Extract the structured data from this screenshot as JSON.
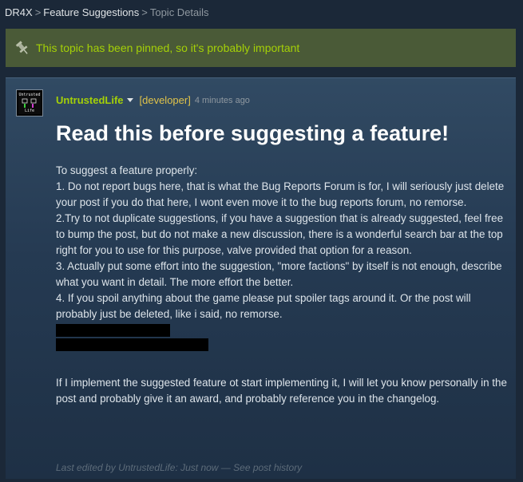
{
  "breadcrumb": {
    "items": [
      "DR4X",
      "Feature Suggestions"
    ],
    "current": "Topic Details",
    "separator": ">"
  },
  "pinned_banner": {
    "icon": "pin-icon",
    "text": "This topic has been pinned, so it's probably important"
  },
  "post": {
    "author": "UntrustedLife",
    "role_tag": "[developer]",
    "time": "4 minutes ago",
    "avatar_text": [
      "Untrusted",
      "Life"
    ],
    "title": "Read this before suggesting a feature!",
    "body": {
      "intro": "To suggest a feature properly:",
      "item1": "1. Do not report bugs here, that is what the Bug Reports Forum is for, I will seriously just delete your post if you do that here, I wont even move it to the bug reports forum, no remorse.",
      "item2": "2.Try to not duplicate suggestions, if you have a suggestion that is already suggested, feel free to bump the post, but do not make a new discussion, there is a wonderful search bar at the top right for you to use for this purpose, valve provided that option for a reason.",
      "item3": "3. Actually put some effort into the suggestion, \"more factions\" by itself is not enough, describe what you want in detail. The more effort the better.",
      "item4": "4. If you spoil anything about the game please put spoiler tags around it. Or the post will probably just be deleted, like i said, no remorse.",
      "closing": "If I implement the suggested feature ot start implementing it, I will let you know personally in the post and probably give it an award, and probably reference you in the changelog."
    },
    "edit": {
      "prefix": "Last edited by",
      "editor": "UntrustedLife",
      "when": ": Just now",
      "dash": " — ",
      "history_link": "See post history"
    }
  },
  "colors": {
    "page_bg": "#1b2838",
    "banner_bg": "#4a5a37",
    "accent_green": "#a4d007",
    "developer_gold": "#e0c34a"
  }
}
